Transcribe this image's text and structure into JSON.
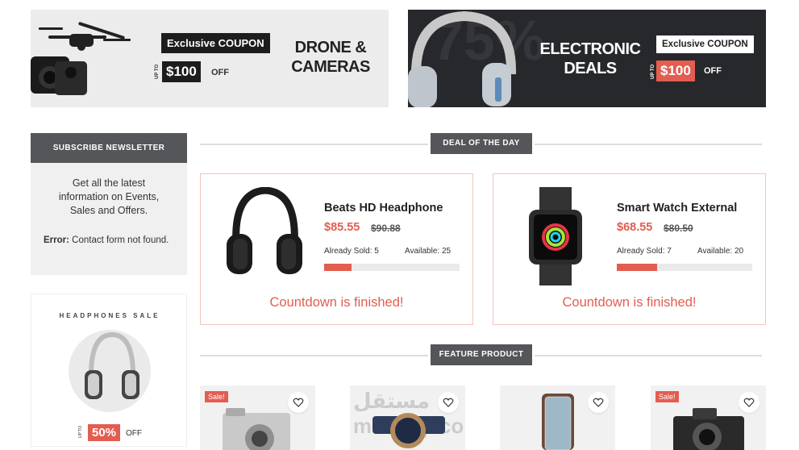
{
  "banners": {
    "left": {
      "coupon_label": "Exclusive COUPON",
      "upto": "UP TO",
      "amount": "$100",
      "off": "OFF",
      "title_line1": "DRONE &",
      "title_line2": "CAMERAS"
    },
    "right": {
      "bg_text": "75%",
      "title_line1": "ELECTRONIC",
      "title_line2": "DEALS",
      "coupon_label": "Exclusive COUPON",
      "upto": "UP TO",
      "amount": "$100",
      "off": "OFF"
    }
  },
  "sidebar": {
    "newsletter_title": "SUBSCRIBE NEWSLETTER",
    "newsletter_text": "Get all the latest information on Events, Sales and Offers.",
    "error_label": "Error:",
    "error_text": "Contact form not found.",
    "sale_title": "HEADPHONES SALE",
    "sale_pct": "50%",
    "sale_off": "OFF",
    "sale_upto": "UP TO"
  },
  "deal_section": {
    "title": "DEAL OF THE DAY",
    "products": [
      {
        "name": "Beats HD Headphone",
        "price": "$85.55",
        "old_price": "$90.88",
        "sold": "Already Sold: 5",
        "available": "Available: 25",
        "progress": 0.2,
        "countdown": "Countdown is finished!",
        "icon": "headphone-image"
      },
      {
        "name": "Smart Watch External",
        "price": "$68.55",
        "old_price": "$80.50",
        "sold": "Already Sold: 7",
        "available": "Available: 20",
        "progress": 0.3,
        "countdown": "Countdown is finished!",
        "icon": "smartwatch-image"
      }
    ]
  },
  "feature_section": {
    "title": "FEATURE PRODUCT",
    "sale_badge": "Sale!",
    "watermark": "مستقل mostaql.com"
  },
  "colors": {
    "accent": "#e35d50",
    "dark": "#555659"
  }
}
